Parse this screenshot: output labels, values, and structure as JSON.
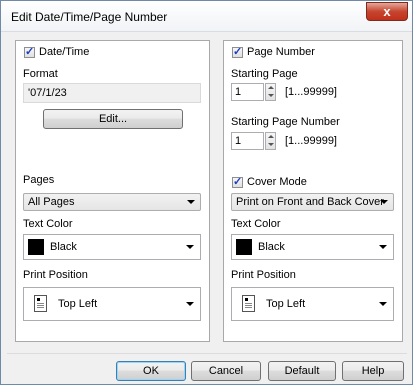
{
  "window": {
    "title": "Edit Date/Time/Page Number",
    "close_glyph": "x"
  },
  "left": {
    "datetime_label": "Date/Time",
    "format_label": "Format",
    "format_value": "'07/1/23",
    "edit_label": "Edit...",
    "pages_label": "Pages",
    "pages_value": "All Pages",
    "text_color_label": "Text Color",
    "text_color_value": "Black",
    "print_position_label": "Print Position",
    "print_position_value": "Top Left"
  },
  "right": {
    "page_number_label": "Page Number",
    "starting_page_label": "Starting Page",
    "starting_page_value": "1",
    "starting_page_range": "[1...99999]",
    "starting_page_number_label": "Starting Page Number",
    "starting_page_number_value": "1",
    "starting_page_number_range": "[1...99999]",
    "cover_mode_label": "Cover Mode",
    "cover_mode_value": "Print on Front and Back Cover",
    "text_color_label": "Text Color",
    "text_color_value": "Black",
    "print_position_label": "Print Position",
    "print_position_value": "Top Left"
  },
  "footer": {
    "ok_label": "OK",
    "cancel_label": "Cancel",
    "default_label": "Default",
    "help_label": "Help"
  },
  "colors": {
    "swatch_black": "#000000",
    "close_red": "#c7452f"
  },
  "icons": [
    "checkbox-checked-icon",
    "spin-up-icon",
    "spin-down-icon",
    "dropdown-arrow-icon",
    "print-position-icon",
    "close-icon"
  ]
}
